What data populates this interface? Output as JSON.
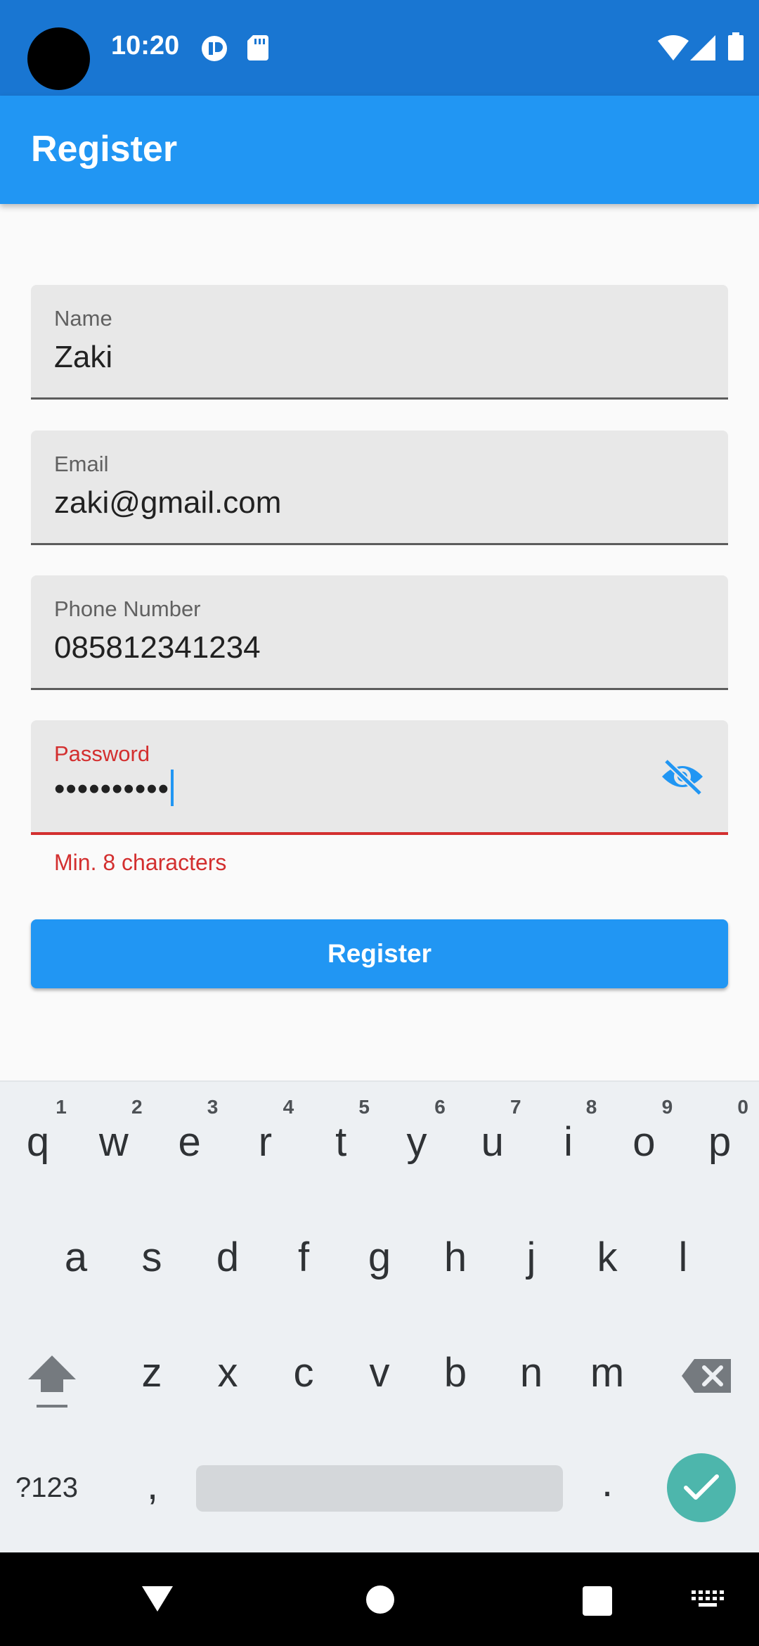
{
  "status_bar": {
    "time": "10:20"
  },
  "app_bar": {
    "title": "Register"
  },
  "form": {
    "name": {
      "label": "Name",
      "value": "Zaki"
    },
    "email": {
      "label": "Email",
      "value": "zaki@gmail.com"
    },
    "phone": {
      "label": "Phone Number",
      "value": "085812341234"
    },
    "password": {
      "label": "Password",
      "value": "••••••••••",
      "error": "Min. 8 characters"
    },
    "submit_label": "Register"
  },
  "keyboard": {
    "row1": [
      "q",
      "w",
      "e",
      "r",
      "t",
      "y",
      "u",
      "i",
      "o",
      "p"
    ],
    "row1_hints": [
      "1",
      "2",
      "3",
      "4",
      "5",
      "6",
      "7",
      "8",
      "9",
      "0"
    ],
    "row2": [
      "a",
      "s",
      "d",
      "f",
      "g",
      "h",
      "j",
      "k",
      "l"
    ],
    "row3": [
      "z",
      "x",
      "c",
      "v",
      "b",
      "n",
      "m"
    ],
    "symbols_label": "?123",
    "comma": ",",
    "period": "."
  },
  "colors": {
    "primary": "#2196f3",
    "status_bar": "#1976d2",
    "error": "#d32f2f",
    "enter_key": "#4db6ac"
  }
}
